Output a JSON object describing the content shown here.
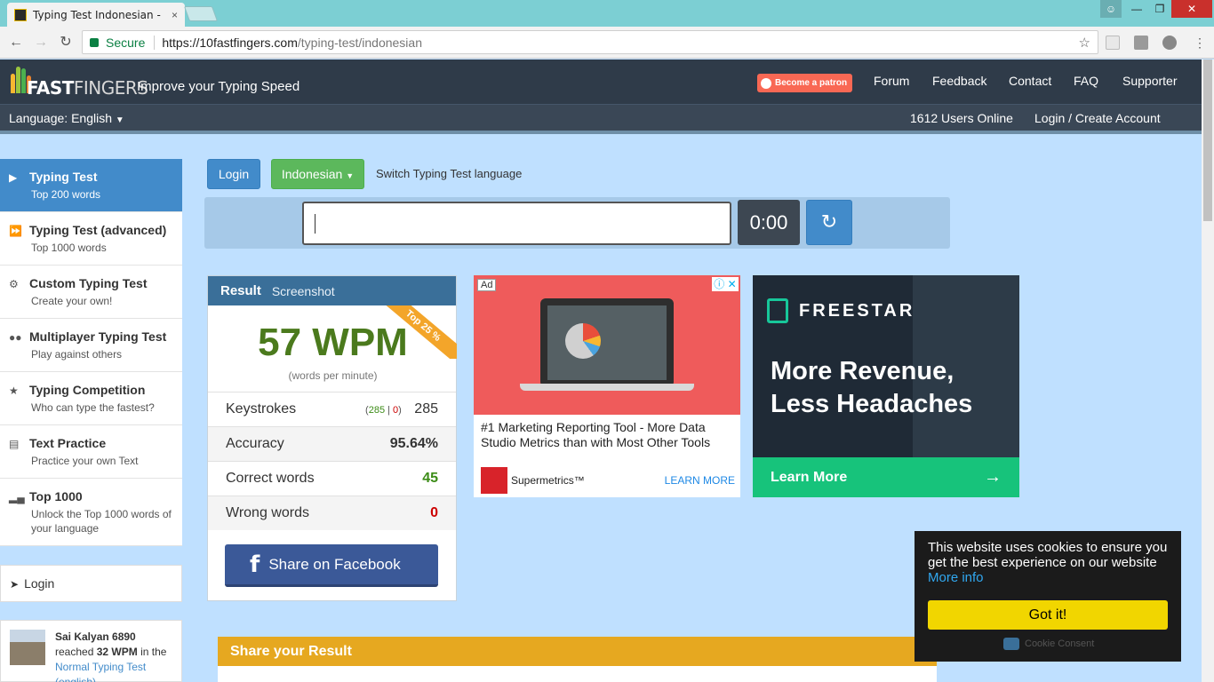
{
  "browser": {
    "tab_title": "Typing Test Indonesian -",
    "tab_close": "×",
    "secure_label": "Secure",
    "url_host": "https://10fastfingers.com",
    "url_path": "/typing-test/indonesian"
  },
  "header": {
    "logo_main": "FAST",
    "logo_thin": "FINGERS",
    "tagline": "Improve your Typing Speed",
    "patron_label": "Become a patron",
    "nav": [
      "Forum",
      "Feedback",
      "Contact",
      "FAQ",
      "Supporter"
    ],
    "language_label": "Language: English",
    "users_online": "1612 Users Online",
    "login_link": "Login / Create Account"
  },
  "sidebar": {
    "items": [
      {
        "title": "Typing Test",
        "subtitle": "Top 200 words",
        "icon": "play-icon"
      },
      {
        "title": "Typing Test (advanced)",
        "subtitle": "Top 1000 words",
        "icon": "fast-forward-icon"
      },
      {
        "title": "Custom Typing Test",
        "subtitle": "Create your own!",
        "icon": "cogs-icon"
      },
      {
        "title": "Multiplayer Typing Test",
        "subtitle": "Play against others",
        "icon": "users-icon"
      },
      {
        "title": "Typing Competition",
        "subtitle": "Who can type the fastest?",
        "icon": "trophy-icon"
      },
      {
        "title": "Text Practice",
        "subtitle": "Practice your own Text",
        "icon": "document-icon"
      },
      {
        "title": "Top 1000",
        "subtitle": "Unlock the Top 1000 words of your language",
        "icon": "signal-icon"
      }
    ],
    "login_label": "Login",
    "recent": {
      "name": "Sai Kalyan 6890",
      "reached": "reached",
      "wpm": "32 WPM",
      "in_the": "in the",
      "test_link": "Normal Typing Test (english)"
    }
  },
  "toolbar": {
    "login_button": "Login",
    "language_button": "Indonesian",
    "switch_text": "Switch Typing Test language",
    "timer": "0:00"
  },
  "result": {
    "title": "Result",
    "screenshot_tab": "Screenshot",
    "ribbon": "Top 25 %",
    "wpm": "57 WPM",
    "wpm_sub": "(words per minute)",
    "keystrokes_label": "Keystrokes",
    "keystrokes_correct": "285",
    "keystrokes_sep": "|",
    "keystrokes_wrong": "0",
    "keystrokes_total": "285",
    "accuracy_label": "Accuracy",
    "accuracy_value": "95.64%",
    "correct_label": "Correct words",
    "correct_value": "45",
    "wrong_label": "Wrong words",
    "wrong_value": "0",
    "facebook_button": "Share on Facebook"
  },
  "ads": {
    "ad_label": "Ad",
    "ad1_description": "#1 Marketing Reporting Tool - More Data Studio Metrics than with Most Other Tools",
    "ad1_brand": "Supermetrics™",
    "ad1_cta": "LEARN MORE",
    "ad2_brand": "FREESTAR",
    "ad2_headline": "More Revenue, Less Headaches",
    "ad2_cta": "Learn More"
  },
  "share": {
    "title": "Share your Result"
  },
  "cookie": {
    "message": "This website uses cookies to ensure you get the best experience on our website",
    "more_info": "More info",
    "button": "Got it!",
    "footer": "Cookie Consent"
  }
}
